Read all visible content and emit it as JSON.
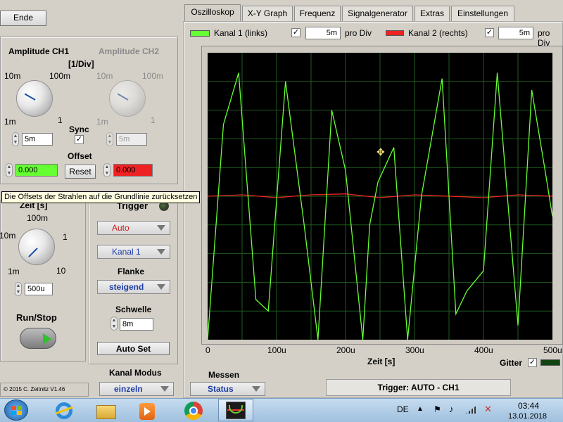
{
  "end_button": "Ende",
  "amplitude": {
    "ch1_title": "Amplitude CH1",
    "ch2_title": "Amplitude CH2",
    "unit": "[1/Div]",
    "knob_labels": {
      "tl": "10m",
      "tr": "100m",
      "bl": "1m",
      "br": "1"
    },
    "ch1_value": "5m",
    "ch2_value": "5m",
    "sync_label": "Sync",
    "offset_label": "Offset",
    "reset_button": "Reset",
    "offset_ch1": "0.000",
    "offset_ch2": "0.000"
  },
  "tooltip": "Die Offsets der Strahlen auf die Grundlinie zurücksetzen",
  "zeit": {
    "title": "Zeit [s]",
    "knob_labels": {
      "top": "100m",
      "tl": "10m",
      "r": "1",
      "bl": "1m",
      "br": "10"
    },
    "value": "500u"
  },
  "run_stop": "Run/Stop",
  "trigger": {
    "title": "Trigger",
    "mode": "Auto",
    "channel": "Kanal 1",
    "flanke_label": "Flanke",
    "flanke": "steigend",
    "schwelle_label": "Schwelle",
    "schwelle": "8m",
    "autoset": "Auto Set"
  },
  "kanal_modus": {
    "label": "Kanal Modus",
    "value": "einzeln"
  },
  "copyright": "© 2015  C. Zeitnitz V1.46",
  "tabs": [
    "Oszilloskop",
    "X-Y Graph",
    "Frequenz",
    "Signalgenerator",
    "Extras",
    "Einstellungen"
  ],
  "legend": {
    "ch1_name": "Kanal 1 (links)",
    "ch1_div": "5m",
    "ch2_name": "Kanal 2 (rechts)",
    "ch2_div": "5m",
    "pro_div": "pro Div",
    "ch1_color": "#66ff33",
    "ch2_color": "#ee2222"
  },
  "chart_data": {
    "type": "line",
    "xlabel": "Zeit [s]",
    "x_ticks": [
      "0",
      "100u",
      "200u",
      "300u",
      "400u",
      "500u"
    ],
    "xlim": [
      0,
      500
    ],
    "ylim": [
      -5,
      5
    ],
    "grid": true,
    "series": [
      {
        "name": "Kanal 1 (links)",
        "x": [
          0,
          23,
          45,
          70,
          88,
          113,
          140,
          160,
          180,
          200,
          225,
          235,
          247,
          270,
          290,
          310,
          340,
          360,
          376,
          400,
          420,
          450,
          470,
          490,
          500
        ],
        "y": [
          -5,
          2.5,
          4.3,
          -3.6,
          -4,
          4,
          -1,
          -5,
          3,
          0.9,
          -5,
          -1,
          0.5,
          1.7,
          -5,
          0,
          4.1,
          -4.1,
          -3.3,
          -2.6,
          4.3,
          -4.5,
          3.7,
          0.8,
          -0.7
        ]
      },
      {
        "name": "Kanal 2 (rechts)",
        "x": [
          0,
          50,
          100,
          150,
          200,
          250,
          300,
          350,
          400,
          450,
          500
        ],
        "y": [
          0,
          0.05,
          -0.05,
          0.05,
          0.08,
          -0.05,
          0.05,
          0,
          -0.05,
          0.05,
          0
        ]
      }
    ]
  },
  "gitter_label": "Gitter",
  "messen": {
    "label": "Messen",
    "value": "Status"
  },
  "trigger_status": "Trigger: AUTO - CH1",
  "taskbar": {
    "lang": "DE",
    "time": "03:44",
    "date": "13.01.2018"
  }
}
